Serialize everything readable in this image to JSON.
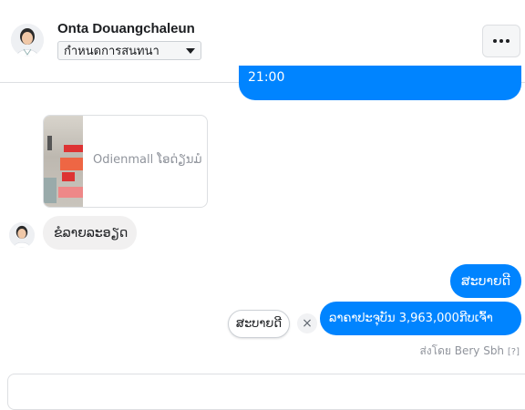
{
  "header": {
    "name": "Onta Douangchaleun",
    "status_select": "กำหนดการสนทนา",
    "more_icon": "more-dots-icon",
    "avatar_icon": "user-photo"
  },
  "messages": {
    "partial_outgoing": "21:00",
    "link_card": {
      "title": "Odienmall ໂອດ່ຽນມໍ"
    },
    "incoming_text": "ຂໍລາຍລະອຽດ",
    "outgoing_1": "ສະບາຍດີ",
    "outgoing_2": "ລາຄາປະຈຸບັນ 3,963,000ກີບເຈົ້າ"
  },
  "quick_reply": {
    "label": "ສະບາຍດີ",
    "dismiss": "×"
  },
  "sent_by": {
    "text": "ส่งโดย Bery Sbh",
    "help": "[?]"
  },
  "colors": {
    "outgoing_bubble": "#0084ff",
    "incoming_bubble": "#f1f0f0",
    "border": "#dddfe2",
    "muted_text": "#90949c"
  }
}
